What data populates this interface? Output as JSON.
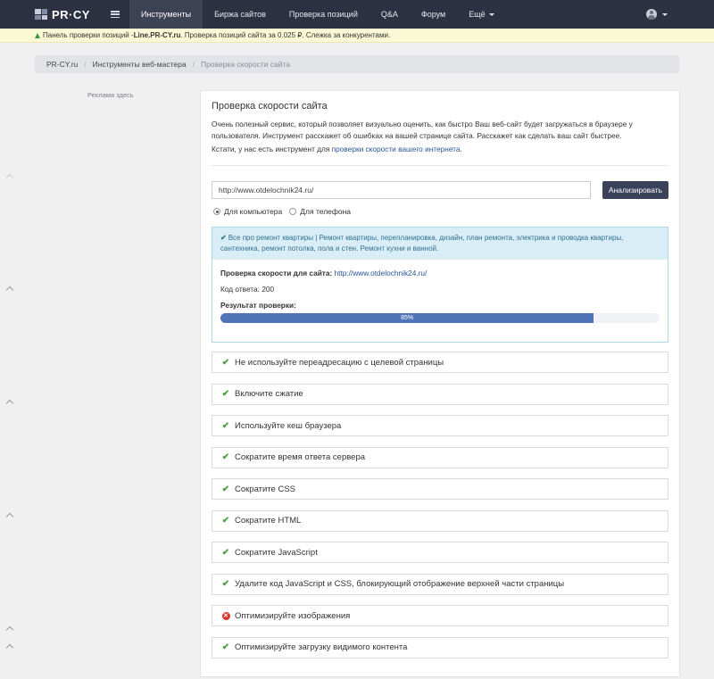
{
  "navbar": {
    "logo": "PR·CY",
    "menu_icon": "menu-icon",
    "items": [
      {
        "label": "Инструменты",
        "active": true
      },
      {
        "label": "Биржа сайтов"
      },
      {
        "label": "Проверка позиций"
      },
      {
        "label": "Q&A"
      },
      {
        "label": "Форум"
      },
      {
        "label": "Ещё",
        "dropdown": true
      }
    ],
    "user_icon": "user-icon"
  },
  "promo": {
    "prefix": "Панель проверки позиций - ",
    "site": "Line.PR-CY.ru",
    "suffix": ". Проверка позиций сайта за 0.025 ₽. Слежка за конкурентами."
  },
  "breadcrumb": {
    "items": [
      "PR-CY.ru",
      "Инструменты веб-мастера"
    ],
    "current": "Проверка скорости сайта"
  },
  "sidebar": {
    "ad_label": "Реклама здесь"
  },
  "main": {
    "title": "Проверка скорости сайта",
    "description": "Очень полезный сервис, который позволяет визуально оценить, как быстро Ваш веб-сайт будет загружаться в браузере у пользователя. Инструмент расскажет об ошибках на вашей странице сайта. Расскажет как сделать ваш сайт быстрее.",
    "note_prefix": "Кстати, у нас есть инструмент для ",
    "note_link": "проверки скорости вашего интернета",
    "note_suffix": ".",
    "url_value": "http://www.otdelochnik24.ru/",
    "analyze_button": "Анализировать",
    "device_options": [
      {
        "label": "Для компьютера",
        "checked": true
      },
      {
        "label": "Для телефона",
        "checked": false
      }
    ]
  },
  "result": {
    "site_title": "Все про ремонт квартиры | Ремонт квартиры, перепланировка, дизайн, план ремонта, электрика и проводка квартиры, сантехника, ремонт потолка, пола и стен. Ремонт кухни и ванной.",
    "speed_check_label": "Проверка скорости для сайта:",
    "speed_check_url": "http://www.otdelochnik24.ru/",
    "response_code": "Код ответа: 200",
    "result_label": "Результат проверки:",
    "score_text": "85%",
    "score": 0.85,
    "progress_color": "#4f74b7"
  },
  "rules": [
    {
      "label": "Не используйте переадресацию с целевой страницы",
      "status": "ok"
    },
    {
      "label": "Включите сжатие",
      "status": "ok"
    },
    {
      "label": "Используйте кеш браузера",
      "status": "ok"
    },
    {
      "label": "Сократите время ответа сервера",
      "status": "ok"
    },
    {
      "label": "Сократите CSS",
      "status": "ok"
    },
    {
      "label": "Сократите HTML",
      "status": "ok"
    },
    {
      "label": "Сократите JavaScript",
      "status": "ok"
    },
    {
      "label": "Удалите код JavaScript и CSS, блокирующий отображение верхней части страницы",
      "status": "ok"
    },
    {
      "label": "Оптимизируйте изображения",
      "status": "error"
    },
    {
      "label": "Оптимизируйте загрузку видимого контента",
      "status": "ok"
    }
  ],
  "colors": {
    "ok": "#4aa33d",
    "error": "#d9342b",
    "navbar": "#2d3142",
    "button": "#39425a"
  }
}
